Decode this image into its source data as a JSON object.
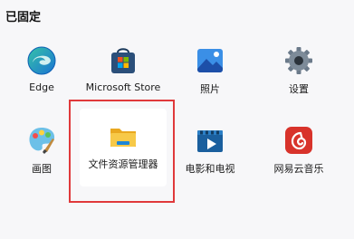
{
  "section": {
    "title": "已固定"
  },
  "apps": [
    {
      "label": "Edge",
      "icon": "edge-icon"
    },
    {
      "label": "Microsoft Store",
      "icon": "microsoft-store-icon"
    },
    {
      "label": "照片",
      "icon": "photos-icon"
    },
    {
      "label": "设置",
      "icon": "settings-gear-icon"
    },
    {
      "label": "画图",
      "icon": "paint-palette-icon"
    },
    {
      "label": "文件资源管理器",
      "icon": "file-explorer-folder-icon"
    },
    {
      "label": "电影和电视",
      "icon": "movies-tv-icon"
    },
    {
      "label": "网易云音乐",
      "icon": "netease-music-icon"
    }
  ],
  "colors": {
    "highlight": "#e0393b",
    "edge": "#1b8ad8",
    "store": "#2b4f7a",
    "photos": "#2f80d8",
    "settings": "#6b7a8a",
    "folder": "#f5c242",
    "movies": "#1b6fb6",
    "netease": "#d8332b"
  }
}
